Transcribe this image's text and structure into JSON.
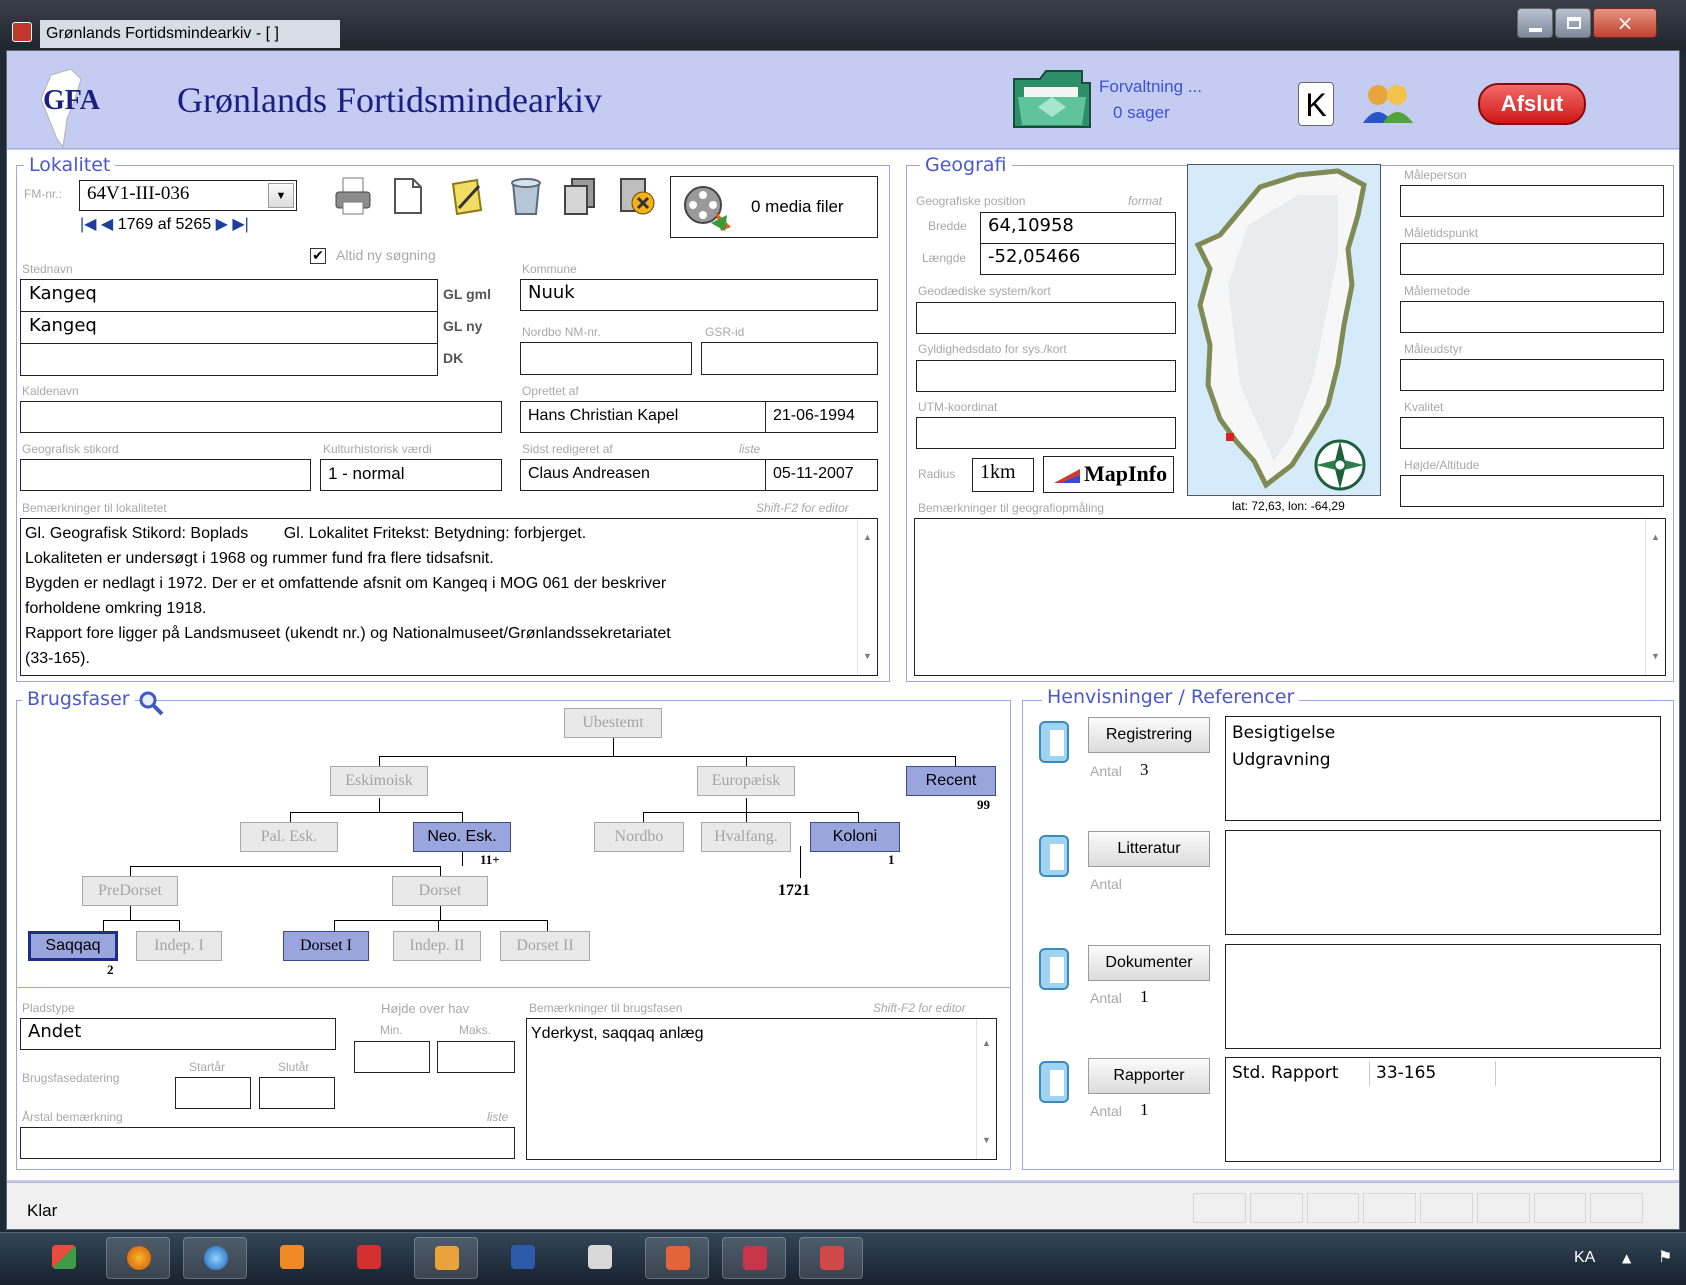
{
  "window": {
    "title": "Grønlands Fortidsmindearkiv - [ ]"
  },
  "header": {
    "logo_text": "GFA",
    "app_title": "Grønlands Fortidsmindearkiv",
    "forvaltning_label": "Forvaltning ...",
    "sager_label": "0 sager",
    "k_label": "K",
    "afslut_label": "Afslut"
  },
  "lokalitet": {
    "title": "Lokalitet",
    "fm_label": "FM-nr.:",
    "fm_value": "64V1-III-036",
    "record_pos": "1769",
    "record_of": "af",
    "record_total": "5265",
    "media_label": "0 media filer",
    "altid_label": "Altid ny søgning",
    "altid_checked": true,
    "stednavn_label": "Stednavn",
    "stednavn_rows": [
      {
        "value": "Kangeq",
        "code": "GL gml"
      },
      {
        "value": "Kangeq",
        "code": "GL ny"
      },
      {
        "value": "",
        "code": "DK"
      }
    ],
    "kommune_label": "Kommune",
    "kommune_value": "Nuuk",
    "nordbo_label": "Nordbo NM-nr.",
    "gsr_label": "GSR-id",
    "kaldenavn_label": "Kaldenavn",
    "oprettet_label": "Oprettet af",
    "oprettet_name": "Hans Christian Kapel",
    "oprettet_date": "21-06-1994",
    "geo_stikord_label": "Geografisk stikord",
    "kultur_label": "Kulturhistorisk værdi",
    "kultur_value": "1 - normal",
    "sidst_label": "Sidst redigeret af",
    "liste_label": "liste",
    "sidst_name": "Claus Andreasen",
    "sidst_date": "05-11-2007",
    "bem_label": "Bemærkninger til lokalitetet",
    "shift_hint": "Shift-F2 for editor",
    "bem_lines": [
      "Gl. Geografisk Stikord: Boplads        Gl. Lokalitet Fritekst: Betydning: forbjerget.",
      "Lokaliteten er undersøgt i 1968 og rummer fund fra flere tidsafsnit.",
      "Bygden er nedlagt i 1972. Der er et omfattende afsnit om Kangeq i MOG 061 der beskriver",
      "forholdene omkring 1918.",
      "Rapport fore ligger på Landsmuseet (ukendt nr.) og Nationalmuseet/Grønlandssekretariatet",
      "(33-165)."
    ]
  },
  "geografi": {
    "title": "Geografi",
    "pos_label": "Geografiske position",
    "format_label": "format",
    "bredde_label": "Bredde",
    "bredde_value": "64,10958",
    "laengde_label": "Længde",
    "laengde_value": "-52,05466",
    "geod_label": "Geodædiske system/kort",
    "gyld_label": "Gyldighedsdato for sys./kort",
    "utm_label": "UTM-koordinat",
    "radius_label": "Radius",
    "radius_value": "1km",
    "mapinfo_label": "MapInfo",
    "map_caption": "lat: 72,63, lon: -64,29",
    "bem_label": "Bemærkninger til geografiopmåling",
    "right_labels": [
      "Måleperson",
      "Måletidspunkt",
      "Målemetode",
      "Måleudstyr",
      "Kvalitet",
      "Højde/Altitude"
    ]
  },
  "brugsfaser": {
    "title": "Brugsfaser",
    "nodes": {
      "ubestemt": "Ubestemt",
      "eskimoisk": "Eskimoisk",
      "europaeisk": "Europæisk",
      "recent": "Recent",
      "pal": "Pal. Esk.",
      "neo": "Neo. Esk.",
      "nordbo": "Nordbo",
      "hvalfang": "Hvalfang.",
      "koloni": "Koloni",
      "predorset": "PreDorset",
      "dorset": "Dorset",
      "saqqaq": "Saqqaq",
      "indep1": "Indep. I",
      "dorset1": "Dorset I",
      "indep2": "Indep. II",
      "dorset2": "Dorset II"
    },
    "counts": {
      "recent": "99",
      "neo": "11+",
      "koloni": "1",
      "saqqaq": "2"
    },
    "year": "1721",
    "pladstype_label": "Pladstype",
    "pladstype_value": "Andet",
    "hojde_label": "Højde over hav",
    "min_label": "Min.",
    "maks_label": "Maks.",
    "datering_label": "Brugsfasedatering",
    "startar_label": "Startår",
    "slutar_label": "Slutår",
    "arstal_label": "Årstal bemærkning",
    "liste_label": "liste",
    "bem_label": "Bemærkninger til brugsfasen",
    "shift_hint": "Shift-F2 for editor",
    "bem_value": "Yderkyst, saqqaq anlæg"
  },
  "henvisninger": {
    "title": "Henvisninger / Referencer",
    "antal_label": "Antal",
    "groups": [
      {
        "button": "Registrering",
        "antal": "3",
        "items": [
          "Besigtigelse",
          "Udgravning"
        ]
      },
      {
        "button": "Litteratur",
        "antal": "",
        "items": []
      },
      {
        "button": "Dokumenter",
        "antal": "1",
        "items": []
      },
      {
        "button": "Rapporter",
        "antal": "1",
        "items": [
          "Std. Rapport",
          "33-165"
        ]
      }
    ]
  },
  "status": {
    "text": "Klar"
  },
  "taskbar": {
    "lang": "KA"
  },
  "colors": {
    "header_bg": "#c5ccf2",
    "accent": "#4a58cc",
    "active_node": "#9aa5de",
    "afslut": "#e01818",
    "map_sea": "#d6ebf9"
  }
}
